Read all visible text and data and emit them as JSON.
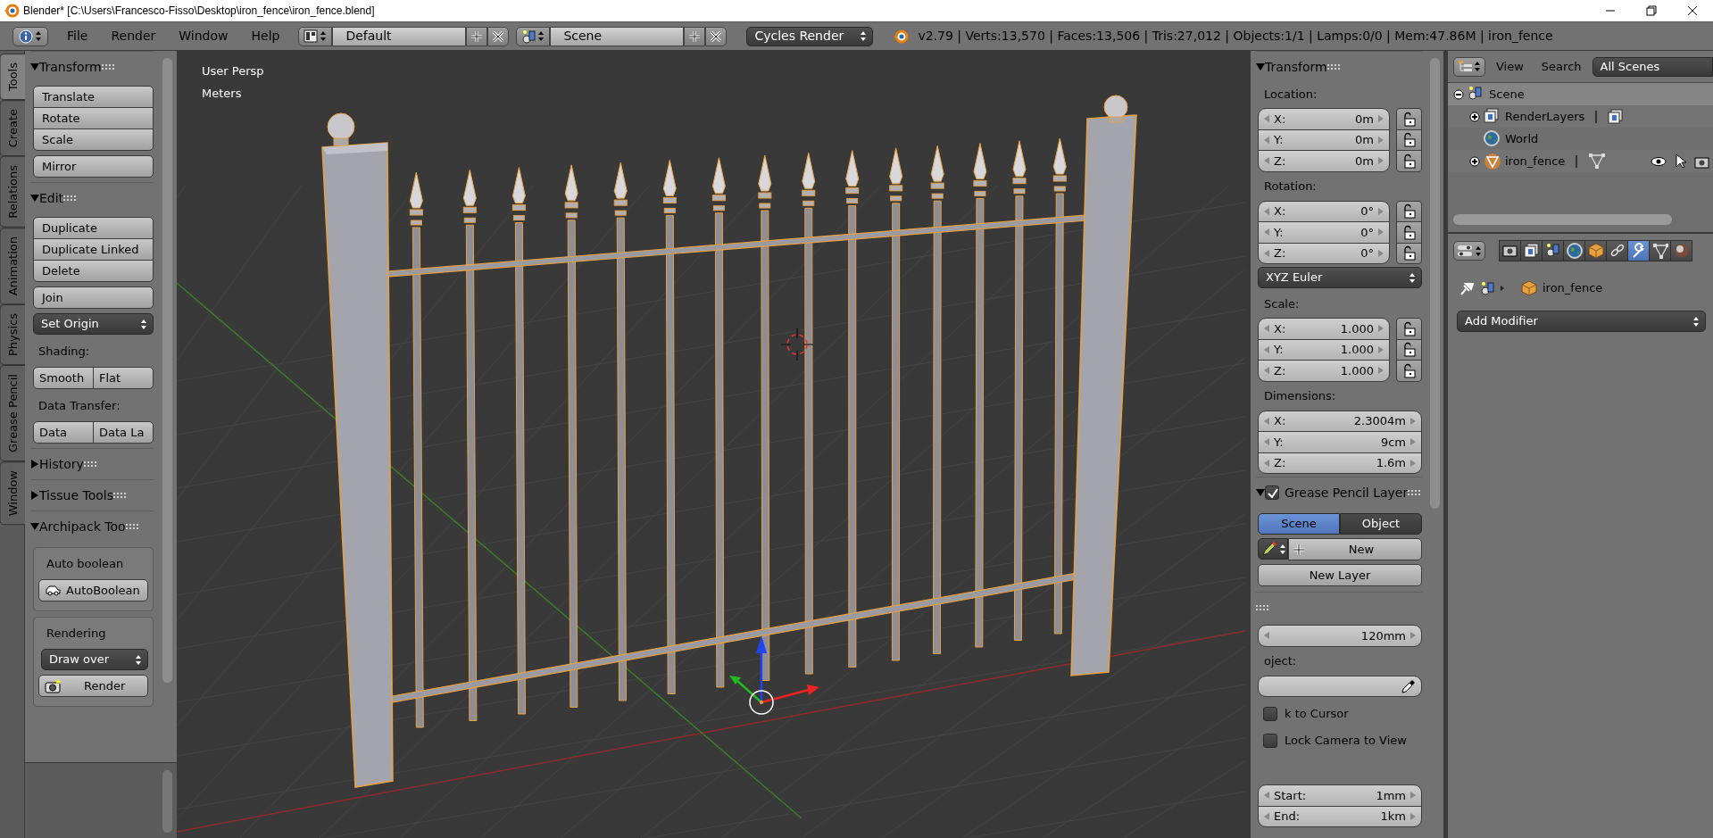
{
  "window": {
    "title": "Blender* [C:\\Users\\Francesco-Fisso\\Desktop\\iron_fence\\iron_fence.blend]"
  },
  "menu_bar": {
    "menus": [
      "File",
      "Render",
      "Window",
      "Help"
    ],
    "screen_layout": "Default",
    "scene": "Scene",
    "render_engine": "Cycles Render",
    "stats": "v2.79 | Verts:13,570 | Faces:13,506 | Tris:27,012 | Objects:1/1 | Lamps:0/0 | Mem:47.86M | iron_fence"
  },
  "tool_tabs": [
    {
      "label": "Tools",
      "selected": true
    },
    {
      "label": "Create",
      "selected": false
    },
    {
      "label": "Relations",
      "selected": false
    },
    {
      "label": "Animation",
      "selected": false
    },
    {
      "label": "Physics",
      "selected": false
    },
    {
      "label": "Grease Pencil",
      "selected": false
    },
    {
      "label": "Window",
      "selected": false
    }
  ],
  "tool_shelf": {
    "panels": [
      {
        "title": "Transform",
        "expanded": true,
        "items": [
          {
            "kind": "buttons",
            "labels": [
              "Translate",
              "Rotate",
              "Scale"
            ]
          },
          {
            "kind": "buttons",
            "labels": [
              "Mirror"
            ]
          }
        ]
      },
      {
        "title": "Edit",
        "expanded": true,
        "items": [
          {
            "kind": "buttons",
            "labels": [
              "Duplicate",
              "Duplicate Linked",
              "Delete"
            ]
          },
          {
            "kind": "buttons",
            "labels": [
              "Join"
            ]
          },
          {
            "kind": "dropdown",
            "value": "Set Origin"
          },
          {
            "kind": "label",
            "text": "Shading:"
          },
          {
            "kind": "row",
            "labels": [
              "Smooth",
              "Flat"
            ]
          },
          {
            "kind": "label",
            "text": "Data Transfer:"
          },
          {
            "kind": "row",
            "labels": [
              "Data",
              "Data La"
            ]
          }
        ]
      },
      {
        "title": "History",
        "expanded": false
      },
      {
        "title": "Tissue Tools",
        "expanded": false
      },
      {
        "title": "Archipack Too",
        "expanded": true,
        "items": [
          {
            "kind": "box",
            "items": [
              {
                "kind": "label",
                "text": "Auto boolean"
              },
              {
                "kind": "car_button",
                "label": "AutoBoolean"
              }
            ]
          },
          {
            "kind": "box",
            "items": [
              {
                "kind": "label",
                "text": "Rendering"
              },
              {
                "kind": "dropdown",
                "value": "Draw over"
              },
              {
                "kind": "camera_button",
                "label": "Render"
              }
            ]
          }
        ]
      }
    ]
  },
  "viewport": {
    "view_label": "User Persp",
    "units": "Meters"
  },
  "properties_region": {
    "panels": [
      {
        "title": "Transform",
        "expanded": true,
        "items": [
          {
            "kind": "label",
            "text": "Location:"
          },
          {
            "kind": "vector",
            "locks": true,
            "fields": [
              {
                "axis": "X:",
                "value": "0m"
              },
              {
                "axis": "Y:",
                "value": "0m"
              },
              {
                "axis": "Z:",
                "value": "0m"
              }
            ]
          },
          {
            "kind": "label",
            "text": "Rotation:"
          },
          {
            "kind": "vector",
            "locks": true,
            "fields": [
              {
                "axis": "X:",
                "value": "0°"
              },
              {
                "axis": "Y:",
                "value": "0°"
              },
              {
                "axis": "Z:",
                "value": "0°"
              }
            ]
          },
          {
            "kind": "dropdown",
            "value": "XYZ Euler"
          },
          {
            "kind": "label",
            "text": "Scale:"
          },
          {
            "kind": "vector",
            "locks": true,
            "fields": [
              {
                "axis": "X:",
                "value": "1.000"
              },
              {
                "axis": "Y:",
                "value": "1.000"
              },
              {
                "axis": "Z:",
                "value": "1.000"
              }
            ]
          },
          {
            "kind": "label",
            "text": "Dimensions:"
          },
          {
            "kind": "vector",
            "locks": false,
            "fields": [
              {
                "axis": "X:",
                "value": "2.3004m"
              },
              {
                "axis": "Y:",
                "value": "9cm"
              },
              {
                "axis": "Z:",
                "value": "1.6m"
              }
            ]
          }
        ]
      },
      {
        "title": "Grease Pencil Layer",
        "expanded": true,
        "checked": true,
        "items": [
          {
            "kind": "toggle",
            "options": [
              {
                "label": "Scene",
                "selected": true
              },
              {
                "label": "Object",
                "selected": false
              }
            ]
          },
          {
            "kind": "pencil_new",
            "label": "New"
          },
          {
            "kind": "button",
            "label": "New Layer"
          }
        ]
      },
      {
        "items": [
          {
            "kind": "vector",
            "locks": false,
            "fields": [
              {
                "value": "120mm"
              }
            ]
          },
          {
            "kind": "label",
            "text": "oject:"
          },
          {
            "kind": "picker"
          },
          {
            "kind": "check",
            "label": "k to Cursor",
            "checked": false
          },
          {
            "kind": "check",
            "label": "Lock Camera to View",
            "checked": false
          },
          {
            "kind": "vector",
            "locks": false,
            "fields": [
              {
                "axis": "Start:",
                "value": "1mm"
              },
              {
                "axis": "End:",
                "value": "1km"
              }
            ]
          }
        ]
      }
    ]
  },
  "outliner": {
    "menus": [
      "View",
      "Search"
    ],
    "display_mode": "All Scenes",
    "tree": [
      {
        "label": "Scene",
        "kind": "scene",
        "expanded": true,
        "selected": true,
        "children": [
          {
            "label": "RenderLayers",
            "kind": "render_layers",
            "expanded": false,
            "selected": false
          },
          {
            "label": "World",
            "kind": "world",
            "selected": false
          },
          {
            "label": "iron_fence",
            "kind": "mesh_object",
            "expanded": false,
            "selected": false
          }
        ]
      }
    ]
  },
  "properties_editor": {
    "tabs": [
      {
        "kind": "render",
        "selected": false
      },
      {
        "kind": "render_layers",
        "selected": false
      },
      {
        "kind": "scene",
        "selected": false
      },
      {
        "kind": "world",
        "selected": false
      },
      {
        "kind": "object",
        "selected": false
      },
      {
        "kind": "constraints",
        "selected": false
      },
      {
        "kind": "modifiers",
        "selected": true
      },
      {
        "kind": "data",
        "selected": false
      },
      {
        "kind": "material",
        "selected": false
      }
    ],
    "context_object": "iron_fence",
    "add_modifier": "Add Modifier"
  }
}
